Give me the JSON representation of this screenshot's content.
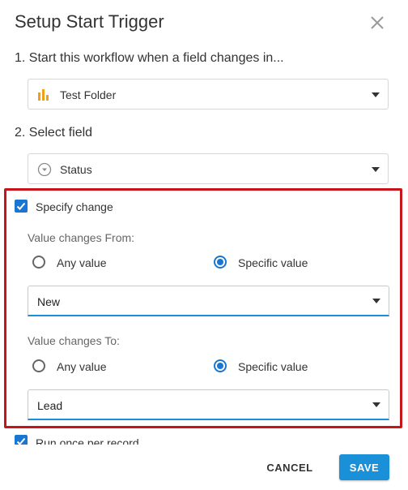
{
  "dialog": {
    "title": "Setup Start Trigger",
    "close_icon": "close-icon"
  },
  "step1": {
    "label": "1. Start this workflow when a field changes in...",
    "select": {
      "icon": "bar-chart-icon",
      "value": "Test Folder"
    }
  },
  "step2": {
    "label": "2. Select field",
    "select": {
      "icon": "dropdown-circle-icon",
      "value": "Status"
    }
  },
  "specify_change": {
    "label": "Specify change",
    "checked": true,
    "from": {
      "label": "Value changes From:",
      "options": [
        "Any value",
        "Specific value"
      ],
      "selected": "Specific value",
      "value": "New"
    },
    "to": {
      "label": "Value changes To:",
      "options": [
        "Any value",
        "Specific value"
      ],
      "selected": "Specific value",
      "value": "Lead"
    }
  },
  "run_once": {
    "label": "Run once per record",
    "checked": true
  },
  "footer": {
    "cancel_label": "CANCEL",
    "save_label": "SAVE"
  },
  "colors": {
    "accent": "#1976d2",
    "save_button": "#1a90d9",
    "highlight_box": "#c8151b",
    "chart_icon": "#f0a017"
  }
}
